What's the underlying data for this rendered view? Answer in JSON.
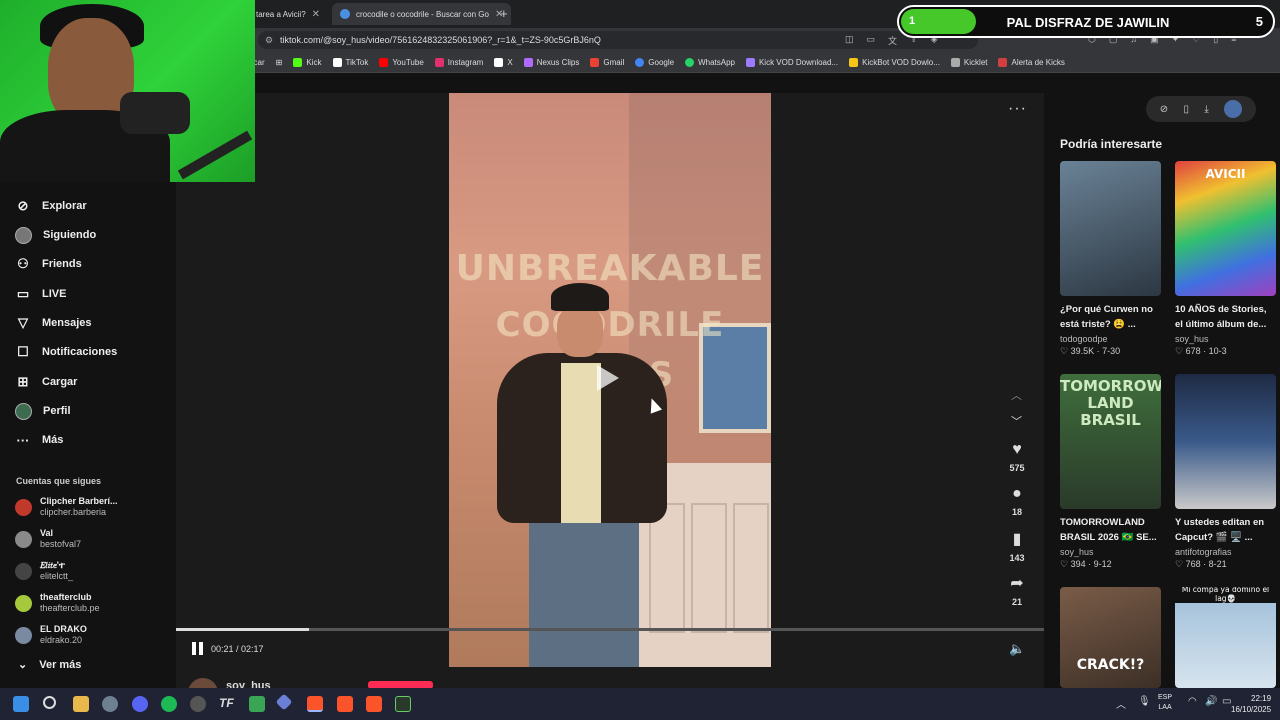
{
  "browser": {
    "tabs": [
      {
        "label": "tarea a Avicii?"
      },
      {
        "label": "crocodile o cocodrile - Buscar con Go"
      }
    ],
    "url": "tiktok.com/@soy_hus/video/7561624832325061906?_r=1&_t=ZS-90c5GrBJ6nQ",
    "bookmarks": [
      {
        "label": "licar",
        "color": "#e0a030"
      },
      {
        "label": "Kick",
        "color": "#53fc18"
      },
      {
        "label": "TikTok",
        "color": "#ffffff"
      },
      {
        "label": "YouTube",
        "color": "#ff0000"
      },
      {
        "label": "Instagram",
        "color": "#e1306c"
      },
      {
        "label": "X",
        "color": "#ffffff"
      },
      {
        "label": "Nexus Clips",
        "color": "#b06aff"
      },
      {
        "label": "Gmail",
        "color": "#ea4335"
      },
      {
        "label": "Google",
        "color": "#4285f4"
      },
      {
        "label": "WhatsApp",
        "color": "#25d366"
      },
      {
        "label": "Kick VOD Download...",
        "color": "#9c7bff"
      },
      {
        "label": "KickBot VOD Dowlo...",
        "color": "#f5c518"
      },
      {
        "label": "Kicklet",
        "color": "#aaaaaa"
      },
      {
        "label": "Alerta de Kicks",
        "color": "#d04040"
      }
    ]
  },
  "goal": {
    "start": "1",
    "title": "PAL DISFRAZ DE JAWILIN",
    "end": "5",
    "progress_fraction": 0.2,
    "fill_color": "#46c72a"
  },
  "sidebar": {
    "nav": [
      {
        "label": "Explorar",
        "icon": "compass-icon"
      },
      {
        "label": "Siguiendo",
        "icon": "avatar"
      },
      {
        "label": "Friends",
        "icon": "friends-icon"
      },
      {
        "label": "LIVE",
        "icon": "live-icon"
      },
      {
        "label": "Mensajes",
        "icon": "messages-icon"
      },
      {
        "label": "Notificaciones",
        "icon": "notifications-icon"
      },
      {
        "label": "Cargar",
        "icon": "upload-icon"
      },
      {
        "label": "Perfil",
        "icon": "profile-avatar"
      },
      {
        "label": "Más",
        "icon": "more-icon"
      }
    ],
    "following_title": "Cuentas que sigues",
    "following": [
      {
        "name": "Clipcher Barberí...",
        "handle": "clipcher.barberia",
        "color": "#c0392b"
      },
      {
        "name": "Val",
        "handle": "bestofval7",
        "color": "#8a8a8a"
      },
      {
        "name": "𝐸𝑙𝑖𝑡𝑒'ተ",
        "handle": "elitelctt_",
        "color": "#444444"
      },
      {
        "name": "theafterclub",
        "handle": "theafterclub.pe",
        "color": "#a5c93a"
      },
      {
        "name": "EL DRAKO",
        "handle": "eldrako.20",
        "color": "#7a8aa0"
      }
    ],
    "see_more": "Ver más"
  },
  "video": {
    "overlay_lines": [
      "UNBREAKABLE",
      "COCODRILE",
      "TEARS"
    ],
    "current_time": "00:21",
    "duration": "02:17",
    "time_display": "00:21 / 02:17",
    "progress_fraction": 0.153,
    "likes": "575",
    "comments": "18",
    "saves": "143",
    "shares": "21",
    "author": "soy_hus"
  },
  "recommended": {
    "title": "Podría interesarte",
    "items": [
      {
        "title": "¿Por qué Curwen no está triste? 😩 ...",
        "author": "todogoodpe",
        "stats": "♡ 39.5K · 7-30",
        "thumb_color": "#3a4a5a"
      },
      {
        "title": "10 AÑOS de Stories, el último álbum de...",
        "author": "soy_hus",
        "stats": "♡ 678 · 10-3",
        "thumb_color": "#8a4ab0",
        "thumb_text": "AVICII"
      },
      {
        "title": "TOMORROWLAND BRASIL 2026 🇧🇷 SE...",
        "author": "soy_hus",
        "stats": "♡ 394 · 9-12",
        "thumb_color": "#3a5a3a",
        "thumb_text": "TOMORROW LAND BRASIL"
      },
      {
        "title": "Y ustedes editan en Capcut? 🎬 🖥️ ...",
        "author": "antifotografias",
        "stats": "♡ 768 · 8-21",
        "thumb_color": "#2a3a5a"
      },
      {
        "title": "",
        "author": "",
        "stats": "",
        "thumb_color": "#5a4a3a",
        "thumb_text": "CRACK!?"
      },
      {
        "title": "",
        "author": "",
        "stats": "",
        "thumb_color": "#9ab0c8",
        "thumb_text": "Mi compa ya domino el lag💀"
      }
    ]
  },
  "taskbar": {
    "lang_top": "ESP",
    "lang_bottom": "LAA",
    "time": "22:19",
    "date": "16/10/2025"
  }
}
